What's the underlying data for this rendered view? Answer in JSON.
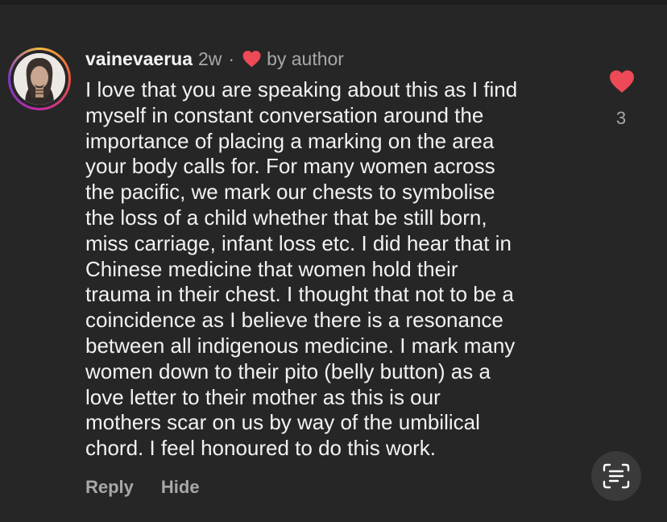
{
  "comment": {
    "username": "vainevaerua",
    "time_ago": "2w",
    "separator": "·",
    "liked_by": "by author",
    "lines": [
      "I love that you are speaking about this as I find",
      "myself in constant conversation around the",
      "importance of placing a marking on the area",
      "your body calls for. For many women across",
      "the pacific, we mark our chests to symbolise",
      "the loss of a child whether that be still born,",
      "miss carriage, infant loss etc. I did hear that in",
      "Chinese medicine that women hold their",
      "trauma in their chest. I thought that not to be a",
      "coincidence as I believe there is a resonance",
      "between all indigenous medicine. I mark many",
      "women down to their pito (belly button) as a",
      "love letter to their mother as this is our",
      "mothers scar on us by way of the umbilical",
      "chord. I feel honoured to do this work."
    ],
    "like_count": "3",
    "liked": true
  },
  "actions": {
    "reply_label": "Reply",
    "hide_label": "Hide"
  },
  "icons": {
    "author_heart": "heart-icon",
    "like": "heart-icon",
    "text_recognition": "text-scan-icon"
  },
  "colors": {
    "background": "#262626",
    "heart": "#ed4956",
    "secondary_text": "#a8a8a8",
    "primary_text": "#f2f2f2"
  }
}
